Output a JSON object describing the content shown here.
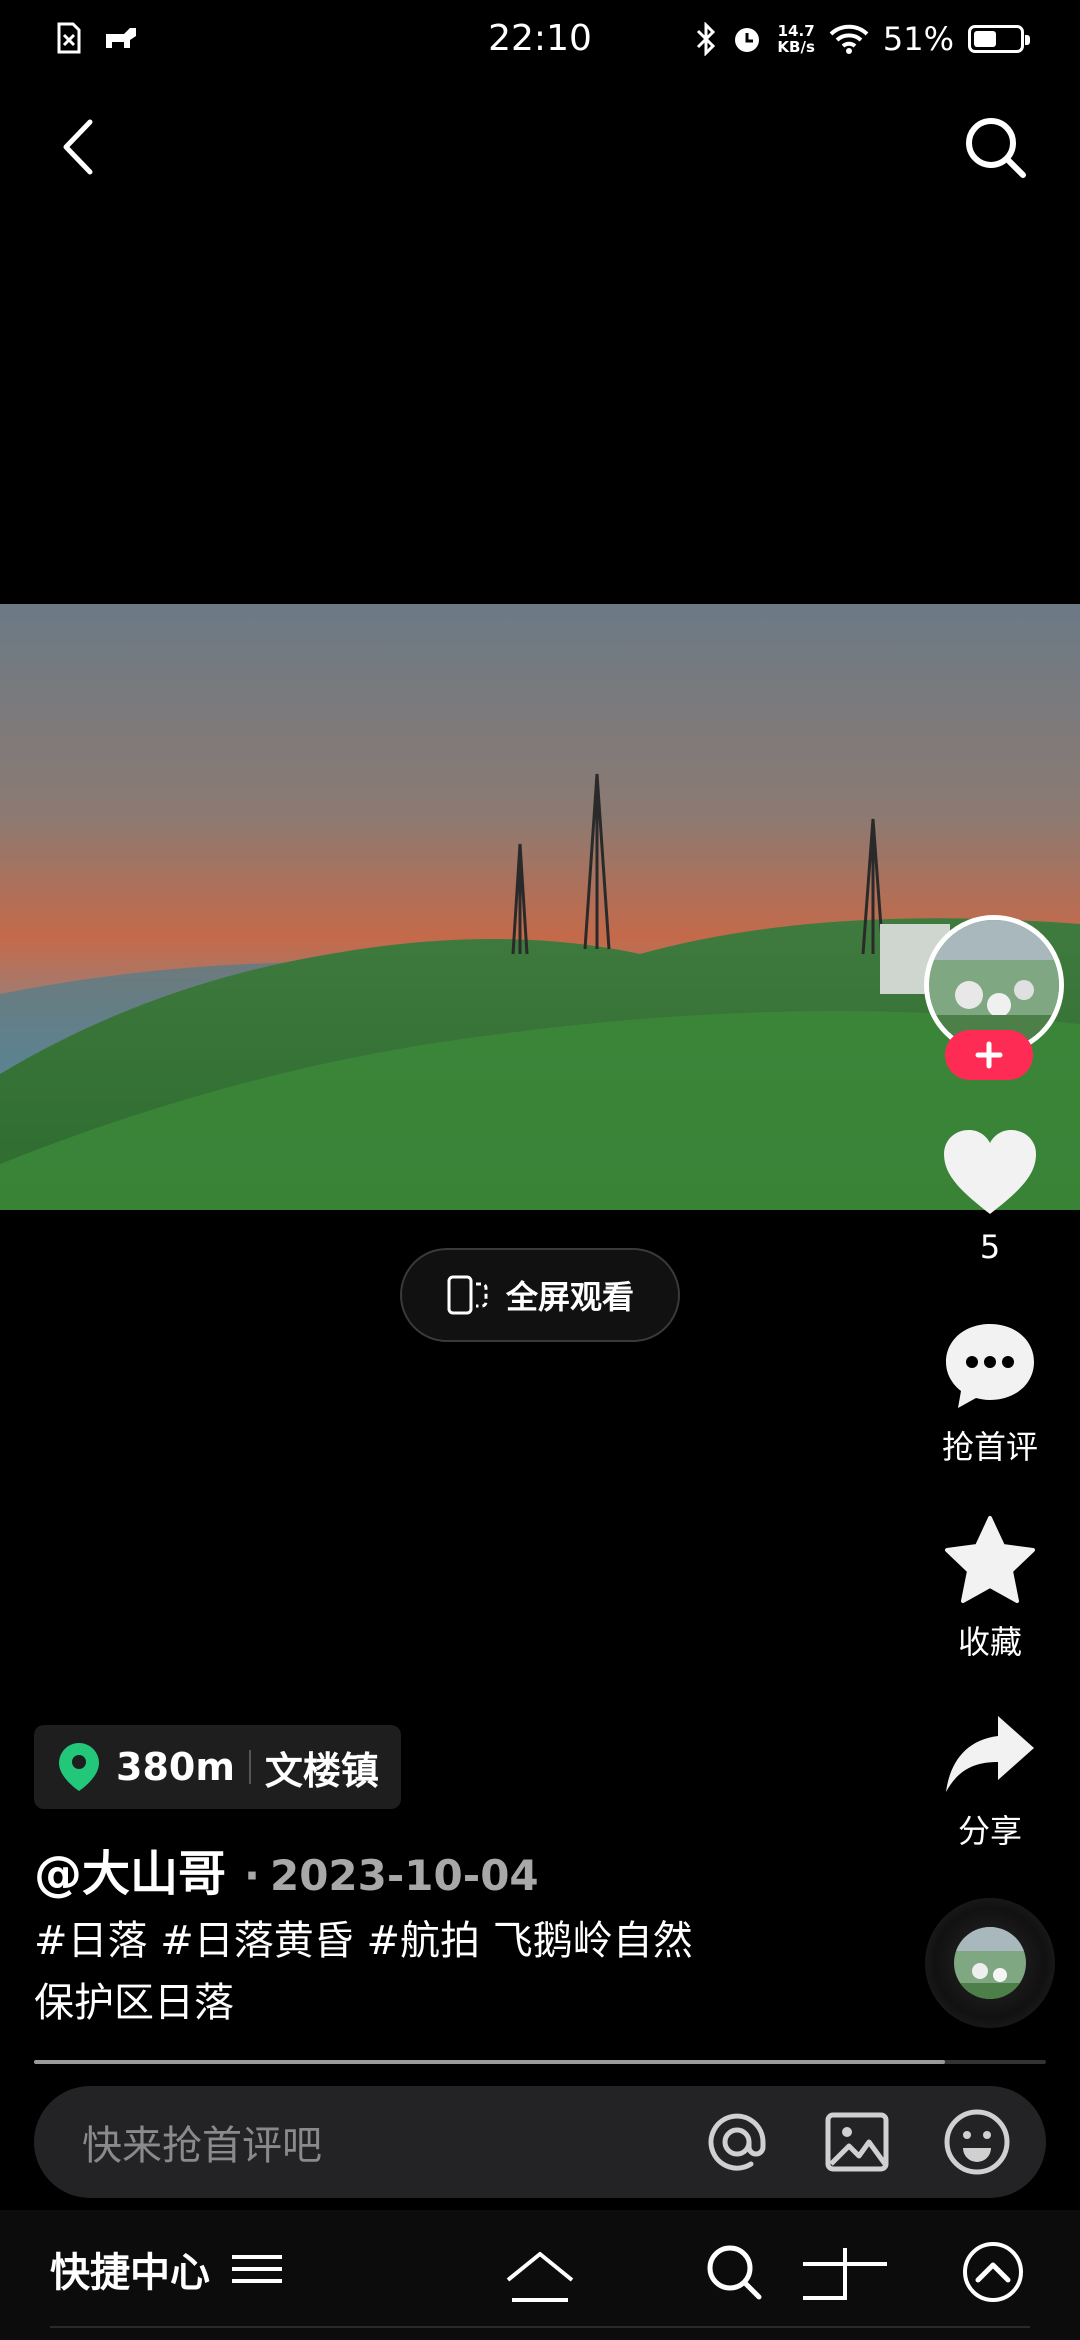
{
  "status_bar": {
    "time": "22:10",
    "net_speed_value": "14.7",
    "net_speed_unit": "KB/s",
    "battery": "51%",
    "battery_level": 0.51
  },
  "location": {
    "distance": "380m",
    "place": "文楼镇"
  },
  "post": {
    "author": "@大山哥",
    "separator": "·",
    "date": "2023-10-04",
    "caption_line1": "#日落 #日落黄昏 #航拍 飞鹅岭自然",
    "caption_line2": "保护区日落",
    "progress": 0.9
  },
  "actions": {
    "like_count": "5",
    "comment_label": "抢首评",
    "favorite_label": "收藏",
    "share_label": "分享"
  },
  "fullscreen_label": "全屏观看",
  "comment_bar": {
    "placeholder": "快来抢首评吧"
  },
  "sysnav": {
    "quick_label": "快捷中心"
  },
  "colors": {
    "accent": "#fe2c55",
    "location_pin": "#22c77a",
    "background": "#000000"
  },
  "icons": [
    "sim-icon",
    "cast-icon",
    "bluetooth-icon",
    "alarm-icon",
    "wifi-icon",
    "battery-icon",
    "back-icon",
    "search-icon",
    "fullscreen-icon",
    "plus-icon",
    "heart-icon",
    "comment-icon",
    "star-icon",
    "share-icon",
    "location-pin-icon",
    "at-icon",
    "image-icon",
    "emoji-icon",
    "menu-icon",
    "home-icon",
    "nav-search-icon",
    "nav-back-icon",
    "nav-up-icon"
  ]
}
